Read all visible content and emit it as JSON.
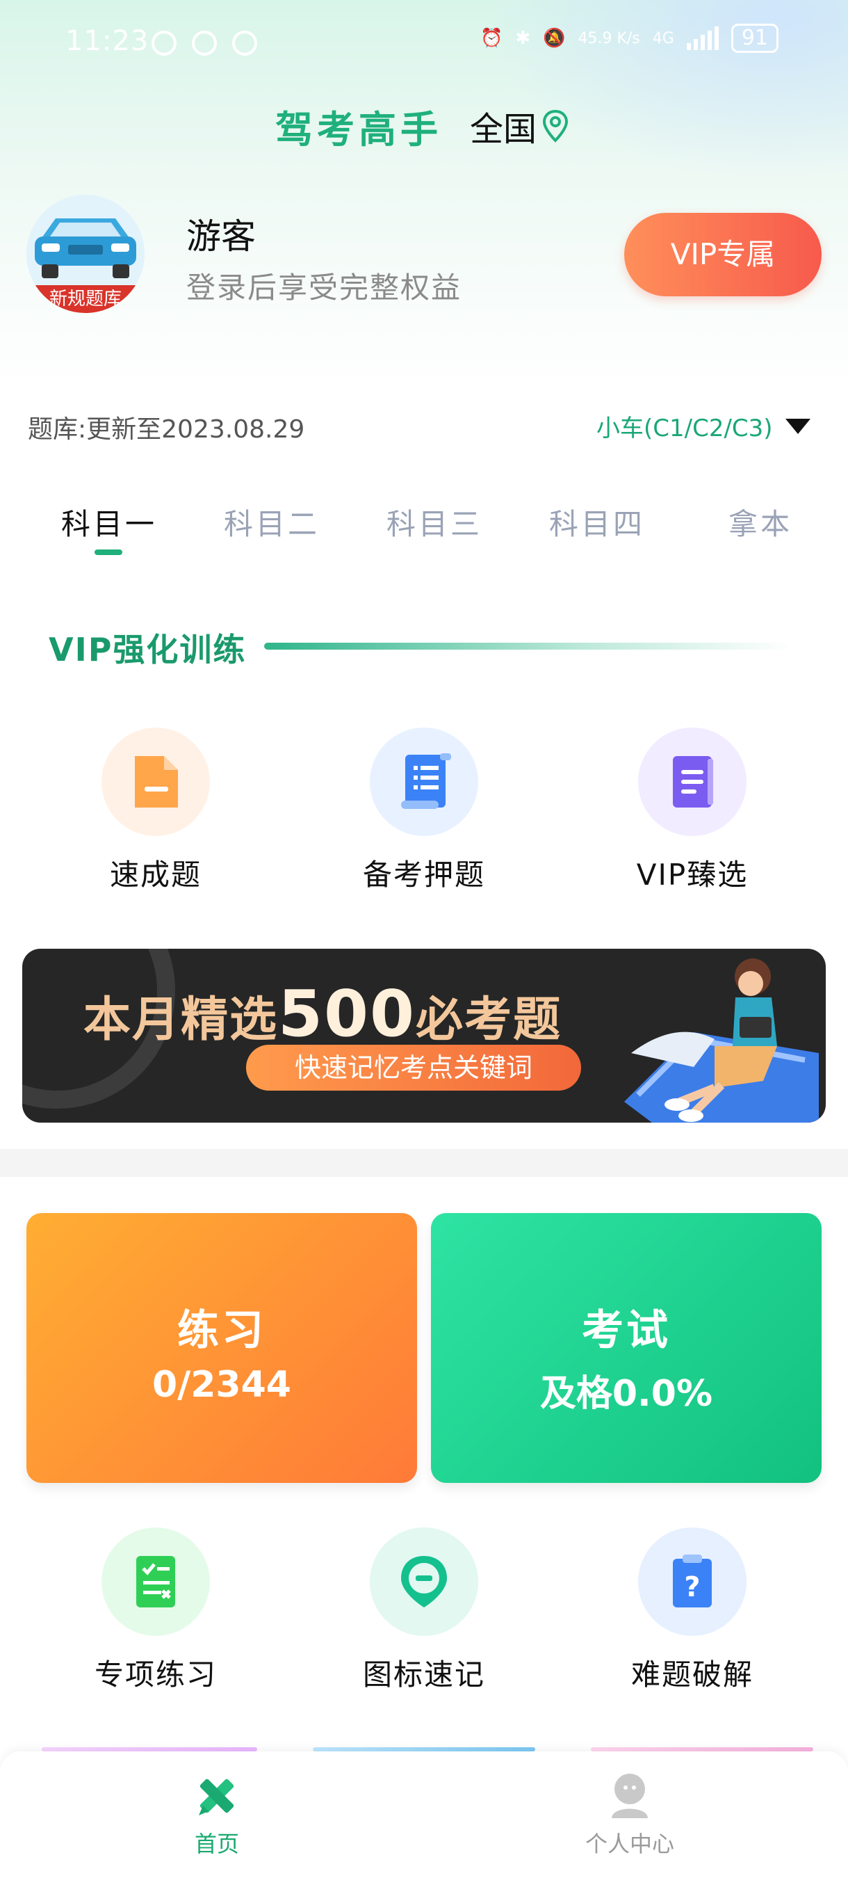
{
  "status_bar": {
    "time": "11:23",
    "net_speed": "45.9 K/s",
    "network": "4G",
    "battery": "91"
  },
  "header": {
    "title": "驾考高手",
    "region": "全国"
  },
  "user": {
    "name": "游客",
    "subtitle": "登录后享受完整权益",
    "avatar_badge": "新规题库",
    "vip_button": "VIP专属"
  },
  "bank": {
    "update_text": "题库:更新至2023.08.29",
    "car_type": "小车(C1/C2/C3)"
  },
  "tabs": [
    {
      "label": "科目一",
      "active": true
    },
    {
      "label": "科目二",
      "active": false
    },
    {
      "label": "科目三",
      "active": false
    },
    {
      "label": "科目四",
      "active": false
    },
    {
      "label": "拿本",
      "active": false
    }
  ],
  "vip_section": {
    "title": "VIP强化训练",
    "items": [
      {
        "label": "速成题",
        "icon": "document-icon"
      },
      {
        "label": "备考押题",
        "icon": "scroll-list-icon"
      },
      {
        "label": "VIP臻选",
        "icon": "book-icon"
      }
    ]
  },
  "banner": {
    "title_prefix": "本月精选",
    "title_number": "500",
    "title_suffix": "必考题",
    "subtitle": "快速记忆考点关键词"
  },
  "cards": {
    "practice": {
      "title": "练习",
      "value": "0/2344"
    },
    "exam": {
      "title": "考试",
      "value": "及格0.0%"
    }
  },
  "features": [
    {
      "label": "专项练习",
      "icon": "checklist-icon"
    },
    {
      "label": "图标速记",
      "icon": "sign-icon"
    },
    {
      "label": "难题破解",
      "icon": "question-clipboard-icon"
    }
  ],
  "bottom_nav": [
    {
      "label": "首页",
      "active": true,
      "icon": "pencil-ruler-icon"
    },
    {
      "label": "个人中心",
      "active": false,
      "icon": "person-icon"
    }
  ],
  "colors": {
    "brand_green": "#1fb07c",
    "vip_orange": "#f75a4c",
    "practice_orange": "#ff7a38",
    "exam_green": "#12c17f"
  }
}
